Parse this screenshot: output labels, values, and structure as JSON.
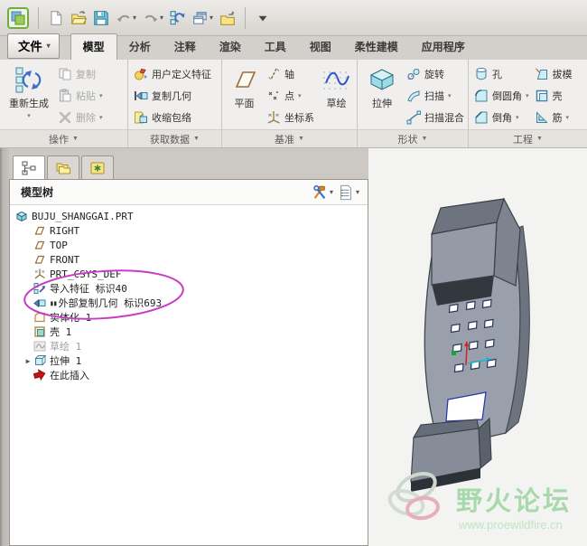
{
  "quick_toolbar": {
    "items": [
      {
        "icon": "app-logo",
        "name": "app-logo"
      },
      {
        "divider": true
      },
      {
        "icon": "new-file",
        "name": "new-file"
      },
      {
        "icon": "open-file",
        "name": "open-file"
      },
      {
        "icon": "save",
        "name": "save"
      },
      {
        "icon": "undo",
        "name": "undo",
        "arrow": true
      },
      {
        "icon": "redo",
        "name": "redo",
        "arrow": true
      },
      {
        "icon": "regenerate-small",
        "name": "regenerate"
      },
      {
        "icon": "windows",
        "name": "windows",
        "arrow": true
      },
      {
        "icon": "close-window",
        "name": "close-window"
      },
      {
        "divider": true
      },
      {
        "icon": "more",
        "name": "toolbar-more"
      }
    ]
  },
  "menu": {
    "file_label": "文件"
  },
  "tabs": [
    {
      "label": "模型",
      "active": true
    },
    {
      "label": "分析"
    },
    {
      "label": "注释"
    },
    {
      "label": "渲染"
    },
    {
      "label": "工具"
    },
    {
      "label": "视图"
    },
    {
      "label": "柔性建模"
    },
    {
      "label": "应用程序"
    }
  ],
  "ribbon": {
    "groups": [
      {
        "label": "操作",
        "columns": [
          {
            "type": "big",
            "label": "重新生成",
            "icon": "regenerate",
            "arrow": true
          },
          {
            "type": "stack",
            "items": [
              {
                "label": "复制",
                "icon": "copy",
                "disabled": true
              },
              {
                "label": "粘贴",
                "icon": "paste",
                "disabled": true,
                "arrow": true
              },
              {
                "label": "删除",
                "icon": "delete",
                "disabled": true,
                "arrow": true
              }
            ]
          }
        ]
      },
      {
        "label": "获取数据",
        "columns": [
          {
            "type": "stack",
            "items": [
              {
                "label": "用户定义特征",
                "icon": "udf"
              },
              {
                "label": "复制几何",
                "icon": "copy-geometry"
              },
              {
                "label": "收缩包络",
                "icon": "shrinkwrap"
              }
            ]
          }
        ]
      },
      {
        "label": "基准",
        "columns": [
          {
            "type": "big",
            "label": "平面",
            "icon": "datum-plane",
            "narrow": true
          },
          {
            "type": "stack",
            "items": [
              {
                "label": "轴",
                "icon": "datum-axis"
              },
              {
                "label": "点",
                "icon": "datum-point",
                "arrow": true
              },
              {
                "label": "坐标系",
                "icon": "datum-csys"
              }
            ]
          },
          {
            "type": "big",
            "label": "草绘",
            "icon": "sketch",
            "narrow": true
          }
        ]
      },
      {
        "label": "形状",
        "columns": [
          {
            "type": "big",
            "label": "拉伸",
            "icon": "extrude",
            "narrow": true
          },
          {
            "type": "stack",
            "items": [
              {
                "label": "旋转",
                "icon": "revolve"
              },
              {
                "label": "扫描",
                "icon": "sweep",
                "arrow": true
              },
              {
                "label": "扫描混合",
                "icon": "swept-blend"
              }
            ]
          }
        ]
      },
      {
        "label": "工程",
        "columns": [
          {
            "type": "stack",
            "items": [
              {
                "label": "孔",
                "icon": "hole"
              },
              {
                "label": "倒圆角",
                "icon": "round",
                "arrow": true
              },
              {
                "label": "倒角",
                "icon": "chamfer",
                "arrow": true
              }
            ]
          },
          {
            "type": "stack",
            "items": [
              {
                "label": "拔模",
                "icon": "draft"
              },
              {
                "label": "壳",
                "icon": "shell"
              },
              {
                "label": "筋",
                "icon": "rib",
                "arrow": true
              }
            ]
          }
        ]
      }
    ]
  },
  "tree_panel": {
    "title": "模型树",
    "items": [
      {
        "label": "BUJU_SHANGGAI.PRT",
        "icon": "part",
        "level": 0
      },
      {
        "label": "RIGHT",
        "icon": "tree-plane",
        "level": 1
      },
      {
        "label": "TOP",
        "icon": "tree-plane",
        "level": 1
      },
      {
        "label": "FRONT",
        "icon": "tree-plane",
        "level": 1
      },
      {
        "label": "PRT_CSYS_DEF",
        "icon": "tree-csys",
        "level": 1
      },
      {
        "label": "导入特征 标识40",
        "icon": "import-feature",
        "level": 1
      },
      {
        "label": "外部复制几何 标识693",
        "icon": "copy-geometry-tree",
        "level": 1,
        "prefix": "▮▮"
      },
      {
        "label": "实体化 1",
        "icon": "solidify",
        "level": 1
      },
      {
        "label": "壳 1",
        "icon": "shell-tree",
        "level": 1
      },
      {
        "label": "草绘 1",
        "icon": "sketch-gray",
        "level": 1,
        "disabled": true
      },
      {
        "label": "拉伸 1",
        "icon": "extrude-tree",
        "level": 1,
        "expand": true
      },
      {
        "label": "在此插入",
        "icon": "insert-here",
        "level": 1
      }
    ]
  },
  "watermark": {
    "title": "野火论坛",
    "url": "www.proewildfire.cn",
    "title_color": "#a8d9ad",
    "url_color": "#c2e4c6"
  },
  "annotation_color": "#c73bc7"
}
